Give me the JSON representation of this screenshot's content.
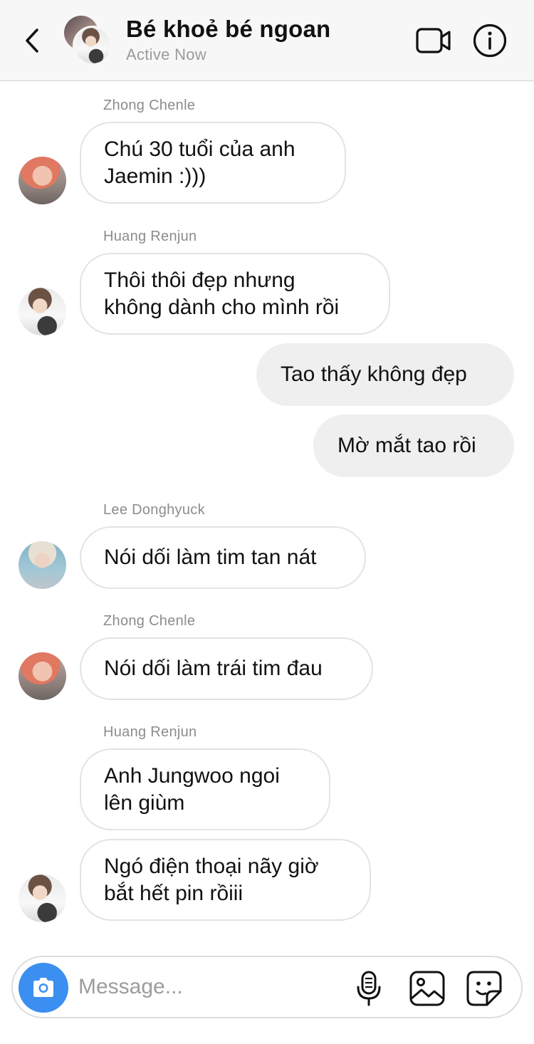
{
  "header": {
    "title": "Bé khoẻ bé ngoan",
    "status": "Active Now"
  },
  "messages": [
    {
      "sender": "Zhong Chenle",
      "lines": [
        "Chú 30 tuổi của anh",
        "Jaemin :)))"
      ]
    },
    {
      "sender": "Huang Renjun",
      "lines": [
        "Thôi thôi đẹp nhưng",
        "không dành cho mình rồi"
      ]
    },
    {
      "from_me": true,
      "lines": [
        "Tao thấy không đẹp"
      ]
    },
    {
      "from_me": true,
      "lines": [
        "Mờ mắt tao rồi"
      ]
    },
    {
      "sender": "Lee Donghyuck",
      "lines": [
        "Nói dối làm tim tan nát"
      ]
    },
    {
      "sender": "Zhong Chenle",
      "lines": [
        "Nói dối làm trái tim đau"
      ]
    },
    {
      "sender": "Huang Renjun",
      "lines": [
        "Anh Jungwoo ngoi",
        "lên giùm"
      ]
    },
    {
      "lines": [
        "Ngó điện thoại nãy giờ",
        "bắt hết pin rồiii"
      ]
    }
  ],
  "composer": {
    "placeholder": "Message..."
  },
  "icons": {
    "back": "chevron-left-icon",
    "video": "video-camera-icon",
    "info": "info-icon",
    "camera": "camera-icon",
    "mic": "microphone-icon",
    "gallery": "image-icon",
    "sticker": "sticker-icon"
  },
  "colors": {
    "accent": "#3b8ff0",
    "my_bubble": "#efefef",
    "their_bubble_border": "#e3e3e3"
  }
}
